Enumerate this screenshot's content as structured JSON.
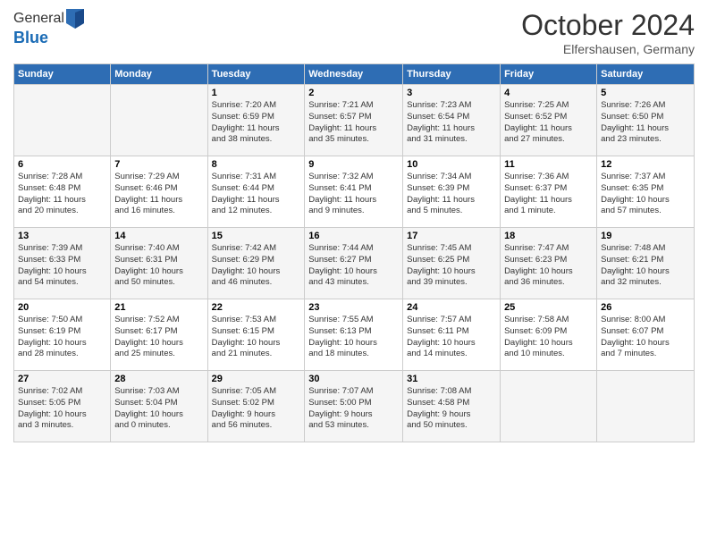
{
  "header": {
    "logo_line1": "General",
    "logo_line2": "Blue",
    "month": "October 2024",
    "location": "Elfershausen, Germany"
  },
  "days_of_week": [
    "Sunday",
    "Monday",
    "Tuesday",
    "Wednesday",
    "Thursday",
    "Friday",
    "Saturday"
  ],
  "weeks": [
    [
      {
        "day": "",
        "info": ""
      },
      {
        "day": "",
        "info": ""
      },
      {
        "day": "1",
        "info": "Sunrise: 7:20 AM\nSunset: 6:59 PM\nDaylight: 11 hours\nand 38 minutes."
      },
      {
        "day": "2",
        "info": "Sunrise: 7:21 AM\nSunset: 6:57 PM\nDaylight: 11 hours\nand 35 minutes."
      },
      {
        "day": "3",
        "info": "Sunrise: 7:23 AM\nSunset: 6:54 PM\nDaylight: 11 hours\nand 31 minutes."
      },
      {
        "day": "4",
        "info": "Sunrise: 7:25 AM\nSunset: 6:52 PM\nDaylight: 11 hours\nand 27 minutes."
      },
      {
        "day": "5",
        "info": "Sunrise: 7:26 AM\nSunset: 6:50 PM\nDaylight: 11 hours\nand 23 minutes."
      }
    ],
    [
      {
        "day": "6",
        "info": "Sunrise: 7:28 AM\nSunset: 6:48 PM\nDaylight: 11 hours\nand 20 minutes."
      },
      {
        "day": "7",
        "info": "Sunrise: 7:29 AM\nSunset: 6:46 PM\nDaylight: 11 hours\nand 16 minutes."
      },
      {
        "day": "8",
        "info": "Sunrise: 7:31 AM\nSunset: 6:44 PM\nDaylight: 11 hours\nand 12 minutes."
      },
      {
        "day": "9",
        "info": "Sunrise: 7:32 AM\nSunset: 6:41 PM\nDaylight: 11 hours\nand 9 minutes."
      },
      {
        "day": "10",
        "info": "Sunrise: 7:34 AM\nSunset: 6:39 PM\nDaylight: 11 hours\nand 5 minutes."
      },
      {
        "day": "11",
        "info": "Sunrise: 7:36 AM\nSunset: 6:37 PM\nDaylight: 11 hours\nand 1 minute."
      },
      {
        "day": "12",
        "info": "Sunrise: 7:37 AM\nSunset: 6:35 PM\nDaylight: 10 hours\nand 57 minutes."
      }
    ],
    [
      {
        "day": "13",
        "info": "Sunrise: 7:39 AM\nSunset: 6:33 PM\nDaylight: 10 hours\nand 54 minutes."
      },
      {
        "day": "14",
        "info": "Sunrise: 7:40 AM\nSunset: 6:31 PM\nDaylight: 10 hours\nand 50 minutes."
      },
      {
        "day": "15",
        "info": "Sunrise: 7:42 AM\nSunset: 6:29 PM\nDaylight: 10 hours\nand 46 minutes."
      },
      {
        "day": "16",
        "info": "Sunrise: 7:44 AM\nSunset: 6:27 PM\nDaylight: 10 hours\nand 43 minutes."
      },
      {
        "day": "17",
        "info": "Sunrise: 7:45 AM\nSunset: 6:25 PM\nDaylight: 10 hours\nand 39 minutes."
      },
      {
        "day": "18",
        "info": "Sunrise: 7:47 AM\nSunset: 6:23 PM\nDaylight: 10 hours\nand 36 minutes."
      },
      {
        "day": "19",
        "info": "Sunrise: 7:48 AM\nSunset: 6:21 PM\nDaylight: 10 hours\nand 32 minutes."
      }
    ],
    [
      {
        "day": "20",
        "info": "Sunrise: 7:50 AM\nSunset: 6:19 PM\nDaylight: 10 hours\nand 28 minutes."
      },
      {
        "day": "21",
        "info": "Sunrise: 7:52 AM\nSunset: 6:17 PM\nDaylight: 10 hours\nand 25 minutes."
      },
      {
        "day": "22",
        "info": "Sunrise: 7:53 AM\nSunset: 6:15 PM\nDaylight: 10 hours\nand 21 minutes."
      },
      {
        "day": "23",
        "info": "Sunrise: 7:55 AM\nSunset: 6:13 PM\nDaylight: 10 hours\nand 18 minutes."
      },
      {
        "day": "24",
        "info": "Sunrise: 7:57 AM\nSunset: 6:11 PM\nDaylight: 10 hours\nand 14 minutes."
      },
      {
        "day": "25",
        "info": "Sunrise: 7:58 AM\nSunset: 6:09 PM\nDaylight: 10 hours\nand 10 minutes."
      },
      {
        "day": "26",
        "info": "Sunrise: 8:00 AM\nSunset: 6:07 PM\nDaylight: 10 hours\nand 7 minutes."
      }
    ],
    [
      {
        "day": "27",
        "info": "Sunrise: 7:02 AM\nSunset: 5:05 PM\nDaylight: 10 hours\nand 3 minutes."
      },
      {
        "day": "28",
        "info": "Sunrise: 7:03 AM\nSunset: 5:04 PM\nDaylight: 10 hours\nand 0 minutes."
      },
      {
        "day": "29",
        "info": "Sunrise: 7:05 AM\nSunset: 5:02 PM\nDaylight: 9 hours\nand 56 minutes."
      },
      {
        "day": "30",
        "info": "Sunrise: 7:07 AM\nSunset: 5:00 PM\nDaylight: 9 hours\nand 53 minutes."
      },
      {
        "day": "31",
        "info": "Sunrise: 7:08 AM\nSunset: 4:58 PM\nDaylight: 9 hours\nand 50 minutes."
      },
      {
        "day": "",
        "info": ""
      },
      {
        "day": "",
        "info": ""
      }
    ]
  ]
}
